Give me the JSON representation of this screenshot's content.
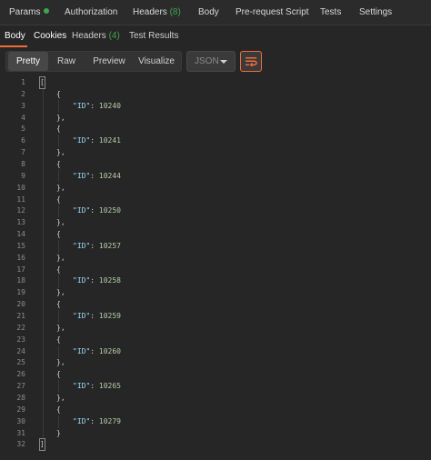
{
  "request_tabs": [
    {
      "label": "Params",
      "dot": true
    },
    {
      "label": "Authorization"
    },
    {
      "label": "Headers",
      "count": "(8)"
    },
    {
      "label": "Body"
    },
    {
      "label": "Pre-request Script"
    },
    {
      "label": "Tests"
    },
    {
      "label": "Settings"
    }
  ],
  "response_tabs": {
    "body": "Body",
    "cookies": "Cookies",
    "headers": "Headers",
    "headers_count": "(4)",
    "test_results": "Test Results"
  },
  "view_modes": {
    "pretty": "Pretty",
    "raw": "Raw",
    "preview": "Preview",
    "visualize": "Visualize"
  },
  "format_select": {
    "value": "JSON"
  },
  "json_key": "\"ID\"",
  "ids": [
    "10240",
    "10241",
    "10244",
    "10250",
    "10257",
    "10258",
    "10259",
    "10260",
    "10265",
    "10279"
  ],
  "colors": {
    "accent": "#f26b3a",
    "success": "#3ea64f"
  },
  "icons": {
    "wrap": "wrap-lines-icon",
    "caret": "chevron-down-icon"
  }
}
